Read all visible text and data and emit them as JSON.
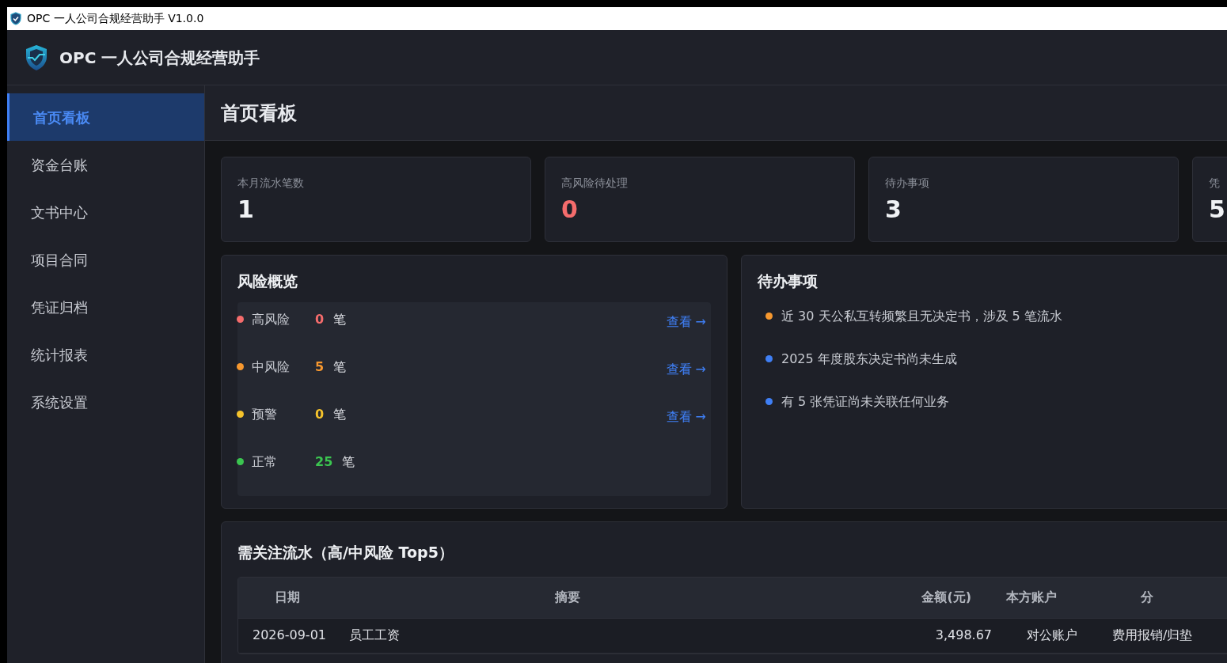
{
  "window": {
    "title": "OPC 一人公司合规经营助手 V1.0.0"
  },
  "app_header": {
    "title": "OPC 一人公司合规经营助手"
  },
  "sidebar": {
    "items": [
      {
        "label": "首页看板",
        "selected": true
      },
      {
        "label": "资金台账",
        "selected": false
      },
      {
        "label": "文书中心",
        "selected": false
      },
      {
        "label": "项目合同",
        "selected": false
      },
      {
        "label": "凭证归档",
        "selected": false
      },
      {
        "label": "统计报表",
        "selected": false
      },
      {
        "label": "系统设置",
        "selected": false
      }
    ]
  },
  "page_title": "首页看板",
  "stats": [
    {
      "label": "本月流水笔数",
      "value": "1",
      "color": "#f0f2f5"
    },
    {
      "label": "高风险待处理",
      "value": "0",
      "color": "#f56c6c"
    },
    {
      "label": "待办事项",
      "value": "3",
      "color": "#f0f2f5"
    },
    {
      "label": "凭",
      "value": "5",
      "color": "#f0f2f5"
    }
  ],
  "risk_overview": {
    "title": "风险概览",
    "rows": [
      {
        "label": "高风险",
        "count": "0",
        "unit": "笔",
        "color": "#f56c6c",
        "link": "查看 →"
      },
      {
        "label": "中风险",
        "count": "5",
        "unit": "笔",
        "color": "#f7982f",
        "link": "查看 →"
      },
      {
        "label": "预警",
        "count": "0",
        "unit": "笔",
        "color": "#f5c32c",
        "link": "查看 →"
      },
      {
        "label": "正常",
        "count": "25",
        "unit": "笔",
        "color": "#3bc550"
      }
    ]
  },
  "todos": {
    "title": "待办事项",
    "items": [
      {
        "text": "近 30 天公私互转频繁且无决定书，涉及 5 笔流水",
        "color": "#f7982f"
      },
      {
        "text": "2025 年度股东决定书尚未生成",
        "color": "#3f7ff5"
      },
      {
        "text": "有 5 张凭证尚未关联任何业务",
        "color": "#3f7ff5"
      }
    ]
  },
  "attention_table": {
    "title": "需关注流水（高/中风险 Top5）",
    "columns": [
      "日期",
      "摘要",
      "金额(元)",
      "本方账户",
      "分"
    ],
    "rows": [
      [
        "2026-09-01",
        "员工工资",
        "3,498.67",
        "对公账户",
        "费用报销/归垫"
      ]
    ]
  }
}
